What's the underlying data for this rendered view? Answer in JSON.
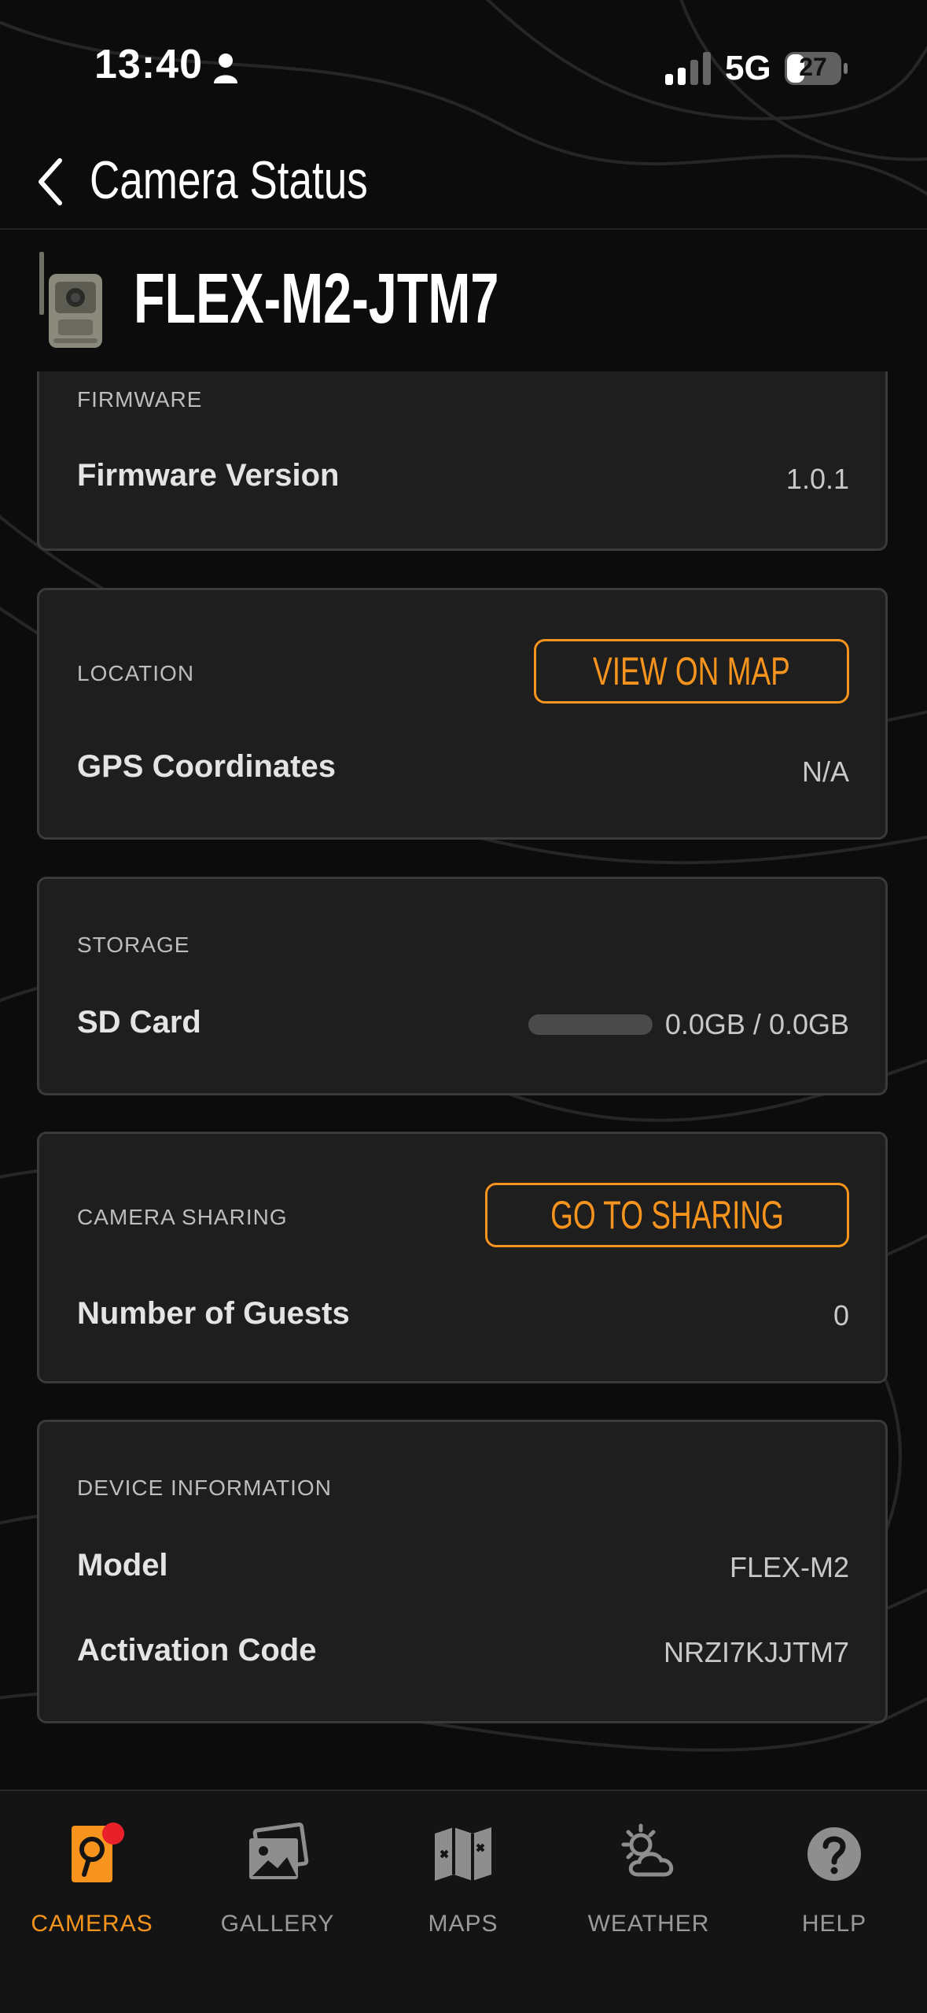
{
  "status_bar": {
    "time": "13:40",
    "network": "5G",
    "battery": "27"
  },
  "header": {
    "title": "Camera Status"
  },
  "device": {
    "name": "FLEX-M2-JTM7"
  },
  "firmware": {
    "section": "FIRMWARE",
    "label": "Firmware Version",
    "value": "1.0.1"
  },
  "location": {
    "section": "LOCATION",
    "button": "VIEW ON MAP",
    "label": "GPS Coordinates",
    "value": "N/A"
  },
  "storage": {
    "section": "STORAGE",
    "label": "SD Card",
    "value": "0.0GB / 0.0GB",
    "used_fraction": 0
  },
  "sharing": {
    "section": "CAMERA SHARING",
    "button": "GO TO SHARING",
    "label": "Number of Guests",
    "value": "0"
  },
  "device_info": {
    "section": "DEVICE INFORMATION",
    "model_label": "Model",
    "model_value": "FLEX-M2",
    "code_label": "Activation Code",
    "code_value": "NRZI7KJJTM7"
  },
  "nav": {
    "items": [
      {
        "label": "CAMERAS",
        "icon": "camera-icon",
        "active": true
      },
      {
        "label": "GALLERY",
        "icon": "gallery-icon"
      },
      {
        "label": "MAPS",
        "icon": "map-icon"
      },
      {
        "label": "WEATHER",
        "icon": "weather-icon"
      },
      {
        "label": "HELP",
        "icon": "help-icon"
      }
    ]
  },
  "colors": {
    "accent": "#f7941d",
    "background": "#0c0c0c",
    "card": "#1e1e1f",
    "badge": "#e8202a"
  }
}
